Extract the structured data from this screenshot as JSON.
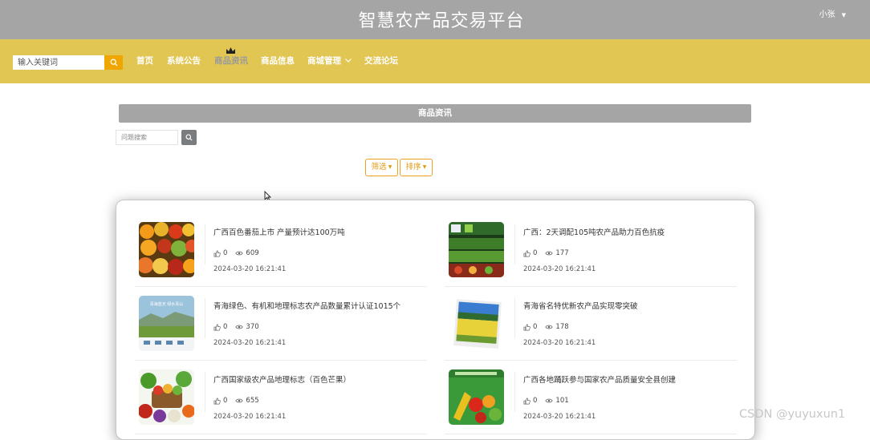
{
  "header": {
    "title": "智慧农产品交易平台",
    "user": "小张"
  },
  "nav": {
    "search_placeholder": "输入关键词",
    "items": [
      "首页",
      "系统公告",
      "商品资讯",
      "商品信息",
      "商城管理",
      "交流论坛"
    ],
    "active_index": 2
  },
  "section": {
    "title": "商品资讯"
  },
  "filters": {
    "title_search_placeholder": "问题搜索",
    "filter_label": "筛选",
    "sort_label": "排序"
  },
  "news": [
    {
      "title": "广西百色番茄上市 产量预计达100万吨",
      "likes": "0",
      "views": "609",
      "date": "2024-03-20 16:21:41"
    },
    {
      "title": "广西：2天调配105吨农产品助力百色抗疫",
      "likes": "0",
      "views": "177",
      "date": "2024-03-20 16:21:41"
    },
    {
      "title": "青海绿色、有机和地理标志农产品数量累计认证1015个",
      "likes": "0",
      "views": "370",
      "date": "2024-03-20 16:21:41"
    },
    {
      "title": "青海省名特优新农产品实现零突破",
      "likes": "0",
      "views": "178",
      "date": "2024-03-20 16:21:41"
    },
    {
      "title": "广西国家级农产品地理标志（百色芒果）",
      "likes": "0",
      "views": "655",
      "date": "2024-03-20 16:21:41"
    },
    {
      "title": "广西各地踊跃参与国家农产品质量安全县创建",
      "likes": "0",
      "views": "101",
      "date": "2024-03-20 16:21:41"
    }
  ],
  "thumb_banner_text": "青海蓝天 绿水青山",
  "watermark": "CSDN @yuyuxun1"
}
